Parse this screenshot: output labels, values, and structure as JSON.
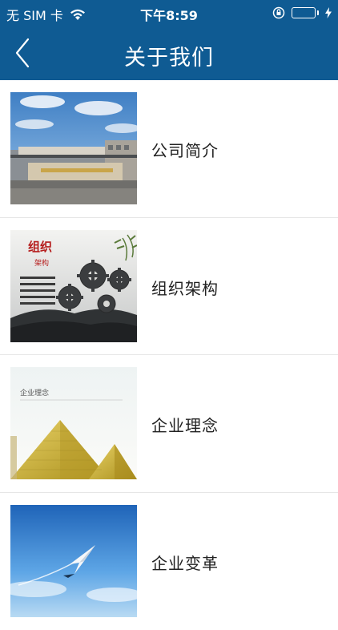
{
  "status_bar": {
    "carrier": "无 SIM 卡",
    "time": "下午8:59"
  },
  "nav": {
    "title": "关于我们"
  },
  "items": [
    {
      "label": "公司简介"
    },
    {
      "label": "组织架构"
    },
    {
      "label": "企业理念"
    },
    {
      "label": "企业变革"
    }
  ],
  "thumbs": {
    "org_title": "组织",
    "org_sub": "架构",
    "philosophy_caption": "企业理念"
  },
  "colors": {
    "nav_bg": "#0f5b93",
    "battery": "#2fd04a"
  }
}
